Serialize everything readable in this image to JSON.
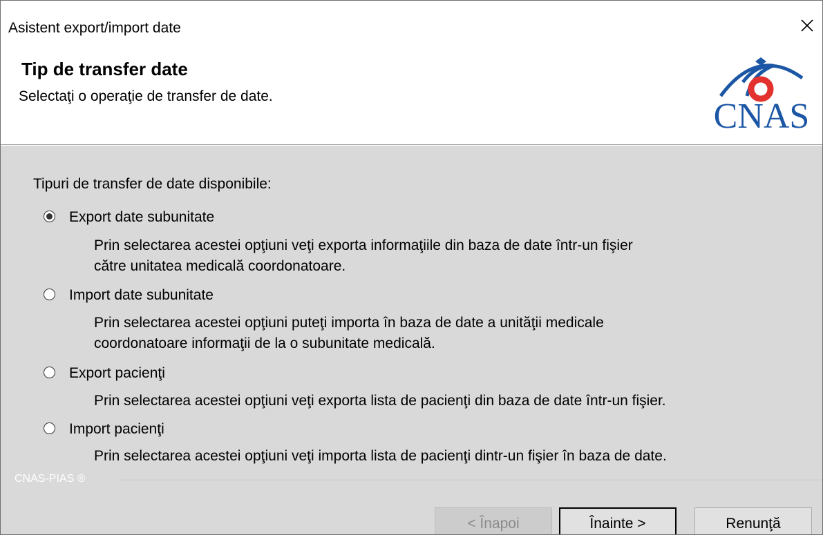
{
  "window": {
    "title": "Asistent export/import date",
    "close_icon": "close-icon"
  },
  "header": {
    "title": "Tip de transfer date",
    "subtitle": "Selectaţi o operaţie de transfer de date.",
    "logo_text": "CNAS"
  },
  "body": {
    "group_label": "Tipuri de transfer de date disponibile:",
    "options": [
      {
        "label": "Export date subunitate",
        "checked": true,
        "description": [
          "Prin selectarea acestei opţiuni veţi exporta informaţiile din baza de date într-un fişier",
          "către unitatea medicală coordonatoare."
        ]
      },
      {
        "label": "Import date subunitate",
        "checked": false,
        "description": [
          "Prin selectarea acestei opţiuni puteţi importa în baza de date a unităţii medicale",
          "coordonatoare informaţii de la o subunitate medicală."
        ]
      },
      {
        "label": "Export pacienţi",
        "checked": false,
        "description": [
          "Prin selectarea acestei opţiuni veţi exporta lista de pacienţi din baza de date într-un fişier."
        ]
      },
      {
        "label": "Import pacienţi",
        "checked": false,
        "description": [
          "Prin selectarea acestei opţiuni veţi importa lista de pacienţi dintr-un fişier în baza de date."
        ]
      }
    ]
  },
  "footer": {
    "brand": "CNAS-PIAS ®",
    "back_label": "< Înapoi",
    "next_label": "Înainte >",
    "cancel_label": "Renunţă"
  },
  "colors": {
    "logo_blue": "#1c57a5",
    "logo_red": "#e3312d",
    "panel_bg": "#d9d9d9"
  }
}
